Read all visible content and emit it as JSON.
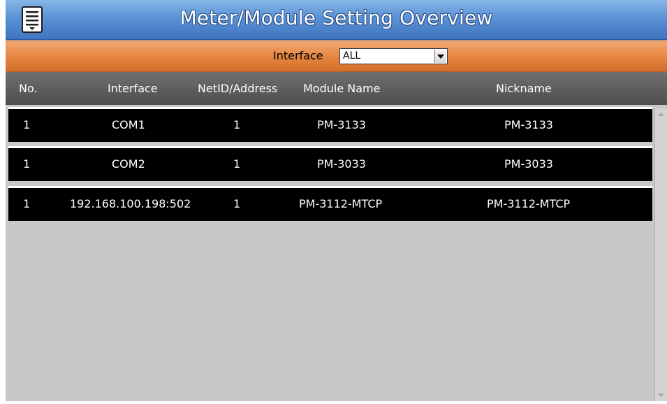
{
  "window": {
    "title": "Meter/Module Setting Overview",
    "menu_icon": "list-menu-icon"
  },
  "filter": {
    "label": "Interface",
    "selected": "ALL"
  },
  "table": {
    "headers": [
      "No.",
      "Interface",
      "NetID/Address",
      "Module Name",
      "Nickname"
    ],
    "rows": [
      {
        "no": "1",
        "interface": "COM1",
        "netid": "1",
        "module": "PM-3133",
        "nickname": "PM-3133"
      },
      {
        "no": "1",
        "interface": "COM2",
        "netid": "1",
        "module": "PM-3033",
        "nickname": "PM-3033"
      },
      {
        "no": "1",
        "interface": "192.168.100.198:502",
        "netid": "1",
        "module": "PM-3112-MTCP",
        "nickname": "PM-3112-MTCP"
      }
    ]
  },
  "colors": {
    "titlebar": "#5b92d6",
    "filterbar": "#e5843f",
    "header": "#5a5a5a",
    "row_bg": "#000000",
    "background": "#c8c8c8"
  }
}
